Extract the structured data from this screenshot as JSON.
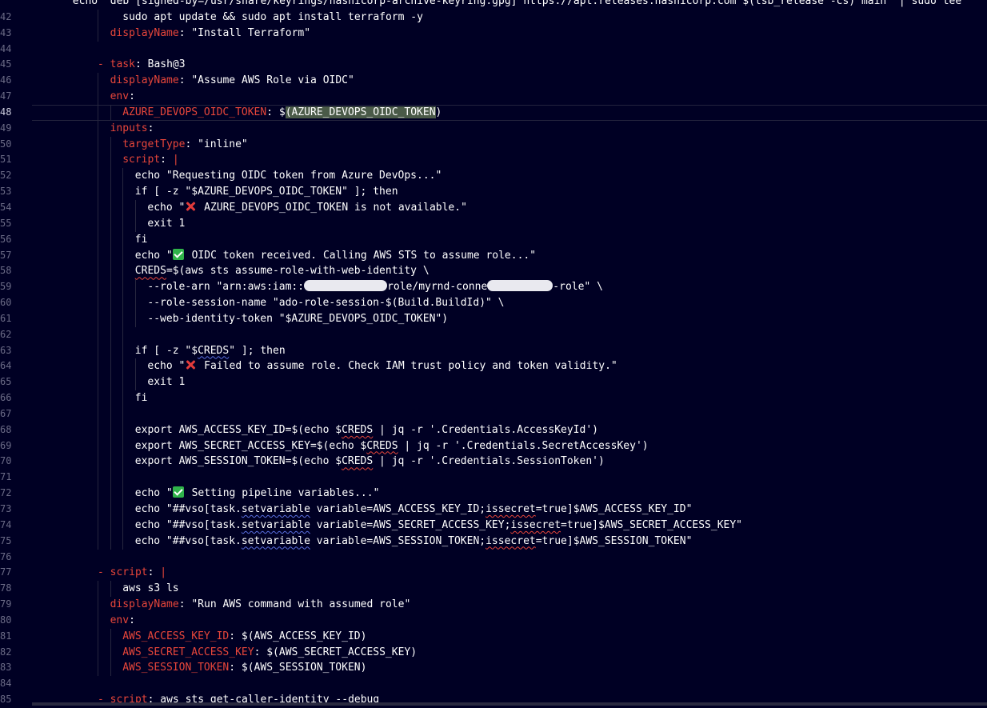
{
  "editor": {
    "partial_first_line": "echo \"deb [signed-by=/usr/share/keyrings/hashicorp-archive-keyring.gpg] https://apt.releases.hashicorp.com $(lsb_release -cs) main\" | sudo tee",
    "current_line": 48,
    "lines": [
      {
        "n": "42",
        "indent": 1,
        "tokens": [
          {
            "t": "  sudo apt update && sudo apt install terraform -y",
            "c": "c"
          }
        ]
      },
      {
        "n": "43",
        "indent": 1,
        "tokens": [
          {
            "t": "displayName",
            "c": "k"
          },
          {
            "t": ": \"Install Terraform\"",
            "c": "v"
          }
        ]
      },
      {
        "n": "44",
        "indent": 0,
        "tokens": []
      },
      {
        "n": "45",
        "indent": 0,
        "tokens": [
          {
            "t": "- ",
            "c": "d"
          },
          {
            "t": "task",
            "c": "k"
          },
          {
            "t": ": Bash@3",
            "c": "v"
          }
        ]
      },
      {
        "n": "46",
        "indent": 1,
        "tokens": [
          {
            "t": "displayName",
            "c": "k"
          },
          {
            "t": ": \"Assume AWS Role via OIDC\"",
            "c": "v"
          }
        ]
      },
      {
        "n": "47",
        "indent": 1,
        "tokens": [
          {
            "t": "env",
            "c": "k"
          },
          {
            "t": ":",
            "c": "v"
          }
        ]
      },
      {
        "n": "48",
        "indent": 2,
        "tokens": [
          {
            "t": "AZURE_DEVOPS_OIDC_TOKEN",
            "c": "k"
          },
          {
            "t": ": $",
            "c": "v"
          },
          {
            "t": "(AZURE_DEVOPS_OIDC_TOKEN",
            "c": "v",
            "hl": true
          },
          {
            "t": ")",
            "c": "v"
          }
        ]
      },
      {
        "n": "49",
        "indent": 1,
        "tokens": [
          {
            "t": "inputs",
            "c": "k"
          },
          {
            "t": ":",
            "c": "v"
          }
        ]
      },
      {
        "n": "50",
        "indent": 2,
        "tokens": [
          {
            "t": "targetType",
            "c": "k"
          },
          {
            "t": ": \"inline\"",
            "c": "v"
          }
        ]
      },
      {
        "n": "51",
        "indent": 2,
        "tokens": [
          {
            "t": "script",
            "c": "k"
          },
          {
            "t": ": ",
            "c": "v"
          },
          {
            "t": "|",
            "c": "d"
          }
        ]
      },
      {
        "n": "52",
        "indent": 3,
        "tokens": [
          {
            "t": "echo \"Requesting OIDC token from Azure DevOps...\"",
            "c": "c"
          }
        ]
      },
      {
        "n": "53",
        "indent": 3,
        "tokens": [
          {
            "t": "if [ -z \"$AZURE_DEVOPS_OIDC_TOKEN\" ]; then",
            "c": "c"
          }
        ]
      },
      {
        "n": "54",
        "indent": 4,
        "tokens": [
          {
            "t": "echo \"",
            "c": "c"
          },
          {
            "emoji": "x"
          },
          {
            "t": " AZURE_DEVOPS_OIDC_TOKEN is not available.\"",
            "c": "c"
          }
        ]
      },
      {
        "n": "55",
        "indent": 4,
        "tokens": [
          {
            "t": "exit 1",
            "c": "c"
          }
        ]
      },
      {
        "n": "56",
        "indent": 3,
        "tokens": [
          {
            "t": "fi",
            "c": "c"
          }
        ]
      },
      {
        "n": "57",
        "indent": 3,
        "tokens": [
          {
            "t": "echo \"",
            "c": "c"
          },
          {
            "emoji": "ok"
          },
          {
            "t": " OIDC token received. Calling AWS STS to assume role...\"",
            "c": "c"
          }
        ]
      },
      {
        "n": "58",
        "indent": 3,
        "tokens": [
          {
            "t": "CREDS",
            "c": "c",
            "sq": "r"
          },
          {
            "t": "=$(aws sts assume-role-with-web-identity \\",
            "c": "c"
          }
        ]
      },
      {
        "n": "59",
        "indent": 4,
        "tokens": [
          {
            "t": "--role-arn \"arn:aws:iam::",
            "c": "c"
          },
          {
            "redact": 104
          },
          {
            "t": "role/myrnd-conne",
            "c": "c"
          },
          {
            "redact": 82
          },
          {
            "t": "-role\" \\",
            "c": "c"
          }
        ]
      },
      {
        "n": "60",
        "indent": 4,
        "tokens": [
          {
            "t": "--role-session-name \"ado-role-session-$(Build.BuildId)\" \\",
            "c": "c"
          }
        ]
      },
      {
        "n": "61",
        "indent": 4,
        "tokens": [
          {
            "t": "--web-identity-token \"$AZURE_DEVOPS_OIDC_TOKEN\")",
            "c": "c"
          }
        ]
      },
      {
        "n": "62",
        "indent": 3,
        "tokens": []
      },
      {
        "n": "63",
        "indent": 3,
        "tokens": [
          {
            "t": "if [ -z \"$",
            "c": "c"
          },
          {
            "t": "CREDS",
            "c": "c",
            "sq": "b"
          },
          {
            "t": "\" ]; then",
            "c": "c"
          }
        ]
      },
      {
        "n": "64",
        "indent": 4,
        "tokens": [
          {
            "t": "echo \"",
            "c": "c"
          },
          {
            "emoji": "x"
          },
          {
            "t": " Failed to assume role. Check IAM trust policy and token validity.\"",
            "c": "c"
          }
        ]
      },
      {
        "n": "65",
        "indent": 4,
        "tokens": [
          {
            "t": "exit 1",
            "c": "c"
          }
        ]
      },
      {
        "n": "66",
        "indent": 3,
        "tokens": [
          {
            "t": "fi",
            "c": "c"
          }
        ]
      },
      {
        "n": "67",
        "indent": 3,
        "tokens": []
      },
      {
        "n": "68",
        "indent": 3,
        "tokens": [
          {
            "t": "export AWS_ACCESS_KEY_ID=$(echo $",
            "c": "c"
          },
          {
            "t": "CREDS",
            "c": "c",
            "sq": "r"
          },
          {
            "t": " | jq -r '.Credentials.AccessKeyId')",
            "c": "c"
          }
        ]
      },
      {
        "n": "69",
        "indent": 3,
        "tokens": [
          {
            "t": "export AWS_SECRET_ACCESS_KEY=$(echo $",
            "c": "c"
          },
          {
            "t": "CREDS",
            "c": "c",
            "sq": "r"
          },
          {
            "t": " | jq -r '.Credentials.SecretAccessKey')",
            "c": "c"
          }
        ]
      },
      {
        "n": "70",
        "indent": 3,
        "tokens": [
          {
            "t": "export AWS_SESSION_TOKEN=$(echo $",
            "c": "c"
          },
          {
            "t": "CREDS",
            "c": "c",
            "sq": "r"
          },
          {
            "t": " | jq -r '.Credentials.SessionToken')",
            "c": "c"
          }
        ]
      },
      {
        "n": "71",
        "indent": 3,
        "tokens": []
      },
      {
        "n": "72",
        "indent": 3,
        "tokens": [
          {
            "t": "echo \"",
            "c": "c"
          },
          {
            "emoji": "ok"
          },
          {
            "t": " Setting pipeline variables...\"",
            "c": "c"
          }
        ]
      },
      {
        "n": "73",
        "indent": 3,
        "tokens": [
          {
            "t": "echo \"##vso[task.",
            "c": "c"
          },
          {
            "t": "setvariable",
            "c": "c",
            "sq": "b"
          },
          {
            "t": " variable=AWS_ACCESS_KEY_ID;",
            "c": "c"
          },
          {
            "t": "issecret",
            "c": "c",
            "sq": "r"
          },
          {
            "t": "=true]$AWS_ACCESS_KEY_ID\"",
            "c": "c"
          }
        ]
      },
      {
        "n": "74",
        "indent": 3,
        "tokens": [
          {
            "t": "echo \"##vso[task.",
            "c": "c"
          },
          {
            "t": "setvariable",
            "c": "c",
            "sq": "b"
          },
          {
            "t": " variable=AWS_SECRET_ACCESS_KEY;",
            "c": "c"
          },
          {
            "t": "issecret",
            "c": "c",
            "sq": "r"
          },
          {
            "t": "=true]$AWS_SECRET_ACCESS_KEY\"",
            "c": "c"
          }
        ]
      },
      {
        "n": "75",
        "indent": 3,
        "tokens": [
          {
            "t": "echo \"##vso[task.",
            "c": "c"
          },
          {
            "t": "setvariable",
            "c": "c",
            "sq": "b"
          },
          {
            "t": " variable=AWS_SESSION_TOKEN;",
            "c": "c"
          },
          {
            "t": "issecret",
            "c": "c",
            "sq": "r"
          },
          {
            "t": "=true]$AWS_SESSION_TOKEN\"",
            "c": "c"
          }
        ]
      },
      {
        "n": "76",
        "indent": 0,
        "tokens": []
      },
      {
        "n": "77",
        "indent": 0,
        "tokens": [
          {
            "t": "- ",
            "c": "d"
          },
          {
            "t": "script",
            "c": "k"
          },
          {
            "t": ": ",
            "c": "v"
          },
          {
            "t": "|",
            "c": "d"
          }
        ]
      },
      {
        "n": "78",
        "indent": 2,
        "tokens": [
          {
            "t": "aws s3 ls",
            "c": "c"
          }
        ]
      },
      {
        "n": "79",
        "indent": 1,
        "tokens": [
          {
            "t": "displayName",
            "c": "k"
          },
          {
            "t": ": \"Run AWS command with assumed role\"",
            "c": "v"
          }
        ]
      },
      {
        "n": "80",
        "indent": 1,
        "tokens": [
          {
            "t": "env",
            "c": "k"
          },
          {
            "t": ":",
            "c": "v"
          }
        ]
      },
      {
        "n": "81",
        "indent": 2,
        "tokens": [
          {
            "t": "AWS_ACCESS_KEY_ID",
            "c": "k"
          },
          {
            "t": ": $(AWS_ACCESS_KEY_ID)",
            "c": "v"
          }
        ]
      },
      {
        "n": "82",
        "indent": 2,
        "tokens": [
          {
            "t": "AWS_SECRET_ACCESS_KEY",
            "c": "k"
          },
          {
            "t": ": $(AWS_SECRET_ACCESS_KEY)",
            "c": "v"
          }
        ]
      },
      {
        "n": "83",
        "indent": 2,
        "tokens": [
          {
            "t": "AWS_SESSION_TOKEN",
            "c": "k"
          },
          {
            "t": ": $(AWS_SESSION_TOKEN)",
            "c": "v"
          }
        ]
      },
      {
        "n": "84",
        "indent": 0,
        "tokens": []
      },
      {
        "n": "85",
        "indent": 0,
        "tokens": [
          {
            "t": "- ",
            "c": "d"
          },
          {
            "t": "script",
            "c": "k"
          },
          {
            "t": ": aws sts get-caller-identity --debug",
            "c": "v"
          }
        ]
      }
    ]
  }
}
